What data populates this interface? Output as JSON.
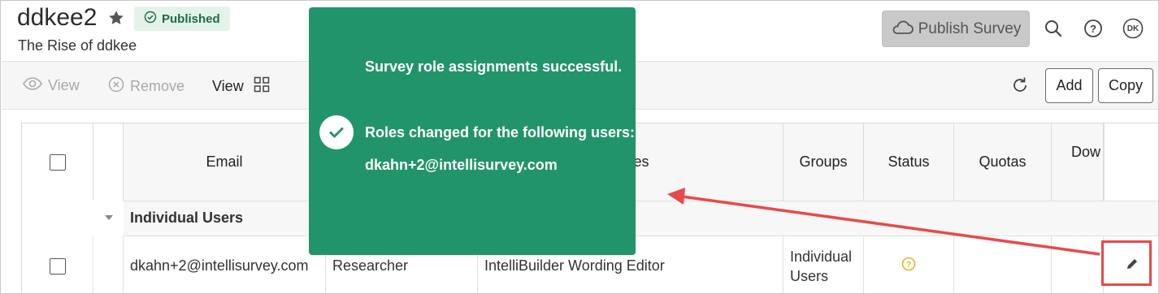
{
  "header": {
    "title": "ddkee2",
    "status_badge": "Published",
    "subtitle": "The Rise of ddkee",
    "publish_button": "Publish Survey",
    "avatar_initials": "DK"
  },
  "toolbar": {
    "view_label": "View",
    "remove_label": "Remove",
    "view_toggle_label": "View",
    "add_label": "Add",
    "copy_label": "Copy"
  },
  "table": {
    "columns": [
      "Email",
      "Roles",
      "Groups",
      "Status",
      "Quotas",
      "Dow"
    ],
    "group_label": "Individual Users",
    "rows": [
      {
        "email": "dkahn+2@intellisurvey.com",
        "role": "Researcher",
        "roles": "IntelliBuilder Wording Editor",
        "groups": "Individual Users"
      }
    ]
  },
  "toast": {
    "line1": "Survey role assignments successful.",
    "line2": "Roles changed for the following users:",
    "line3": "dkahn+2@intellisurvey.com"
  },
  "colors": {
    "toast_bg": "#22946b",
    "badge_bg": "#e3f3ea",
    "annotation": "#e8494b",
    "status_icon": "#e6b31e"
  }
}
